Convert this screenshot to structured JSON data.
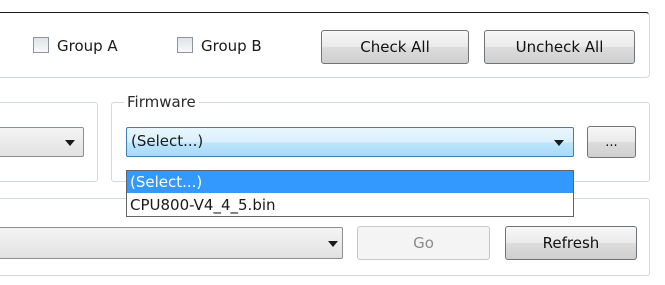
{
  "groups": {
    "group_a_label": "Group A",
    "group_b_label": "Group B",
    "check_all_label": "Check All",
    "uncheck_all_label": "Uncheck All"
  },
  "firmware": {
    "legend": "Firmware",
    "selected": "(Select...)",
    "browse_label": "...",
    "options": [
      "(Select...)",
      "CPU800-V4_4_5.bin"
    ]
  },
  "bottom": {
    "go_label": "Go",
    "refresh_label": "Refresh"
  },
  "colors": {
    "focus_border": "#3c7fb1",
    "selection": "#3399ff"
  }
}
